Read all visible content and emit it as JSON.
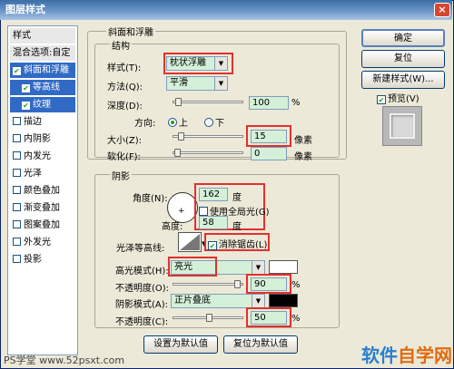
{
  "window": {
    "title": "图层样式",
    "close": "×"
  },
  "left": {
    "header": "样式",
    "blend": "混合选项:自定",
    "items": [
      {
        "label": "斜面和浮雕",
        "checked": true
      },
      {
        "label": "等高线",
        "checked": true
      },
      {
        "label": "纹理",
        "checked": true
      },
      {
        "label": "描边",
        "checked": false
      },
      {
        "label": "内阴影",
        "checked": false
      },
      {
        "label": "内发光",
        "checked": false
      },
      {
        "label": "光泽",
        "checked": false
      },
      {
        "label": "颜色叠加",
        "checked": false
      },
      {
        "label": "渐变叠加",
        "checked": false
      },
      {
        "label": "图案叠加",
        "checked": false
      },
      {
        "label": "外发光",
        "checked": false
      },
      {
        "label": "投影",
        "checked": false
      }
    ]
  },
  "bevel": {
    "title": "斜面和浮雕",
    "structure": {
      "title": "结构",
      "style_label": "样式(T):",
      "style_value": "枕状浮雕",
      "method_label": "方法(Q):",
      "method_value": "平滑",
      "depth_label": "深度(D):",
      "depth_value": "100",
      "depth_unit": "%",
      "direction_label": "方向:",
      "dir_up": "上",
      "dir_down": "下",
      "size_label": "大小(Z):",
      "size_value": "15",
      "size_unit": "像素",
      "soften_label": "软化(F):",
      "soften_value": "0",
      "soften_unit": "像素"
    },
    "shading": {
      "title": "阴影",
      "angle_label": "角度(N):",
      "angle_value": "162",
      "angle_unit": "度",
      "global_light": "使用全局光(G)",
      "altitude_label": "高度:",
      "altitude_value": "58",
      "altitude_unit": "度",
      "gloss_label": "光泽等高线:",
      "antialias": "消除锯齿(L)",
      "highlight_label": "高光模式(H):",
      "highlight_value": "亮光",
      "highlight_color": "#ffffff",
      "opacity1_label": "不透明度(O):",
      "opacity1_value": "90",
      "percent": "%",
      "shadow_label": "阴影模式(A):",
      "shadow_value": "正片叠底",
      "shadow_color": "#000000",
      "opacity2_label": "不透明度(C):",
      "opacity2_value": "50"
    },
    "make_default": "设置为默认值",
    "reset_default": "复位为默认值"
  },
  "right": {
    "ok": "确定",
    "reset": "复位",
    "new_style": "新建样式(W)...",
    "preview": "预览(V)"
  },
  "watermark": {
    "left": "PS学堂 www.52psxt.com",
    "right_a": "软件",
    "right_b": "自学网"
  }
}
